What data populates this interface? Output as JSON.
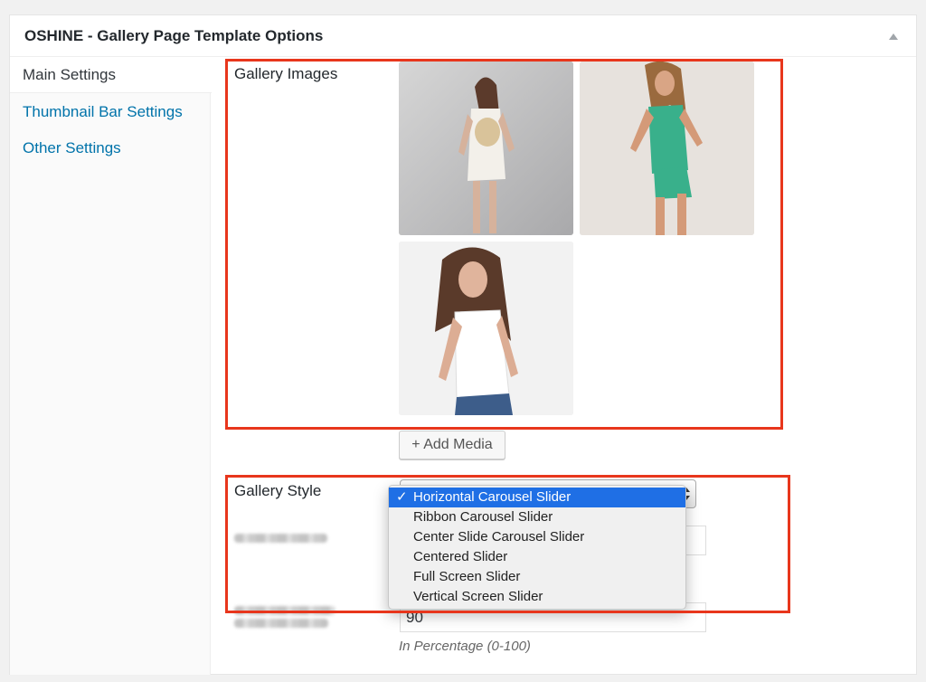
{
  "metabox": {
    "title": "OSHINE - Gallery Page Template Options",
    "toggle_icon": "triangle-up-icon"
  },
  "tabs": [
    {
      "label": "Main Settings",
      "active": true
    },
    {
      "label": "Thumbnail Bar Settings",
      "active": false
    },
    {
      "label": "Other Settings",
      "active": false
    }
  ],
  "gallery": {
    "label": "Gallery Images",
    "images": [
      "photo-woman-white-dress",
      "photo-woman-green-swimsuit",
      "photo-woman-white-tank-top"
    ],
    "add_media_label": "+ Add Media"
  },
  "style": {
    "label": "Gallery Style",
    "options": [
      "Horizontal Carousel Slider",
      "Ribbon Carousel Slider",
      "Center Slide Carousel Slider",
      "Centered Slider",
      "Full Screen Slider",
      "Vertical Screen Slider"
    ],
    "selected_index": 0,
    "check_glyph": "✓"
  },
  "field_percentage": {
    "value": "90",
    "hint": "In Percentage (0-100)"
  },
  "colors": {
    "highlight_border": "#e8361c",
    "link": "#0073aa",
    "selected_option": "#1f6fe5"
  }
}
